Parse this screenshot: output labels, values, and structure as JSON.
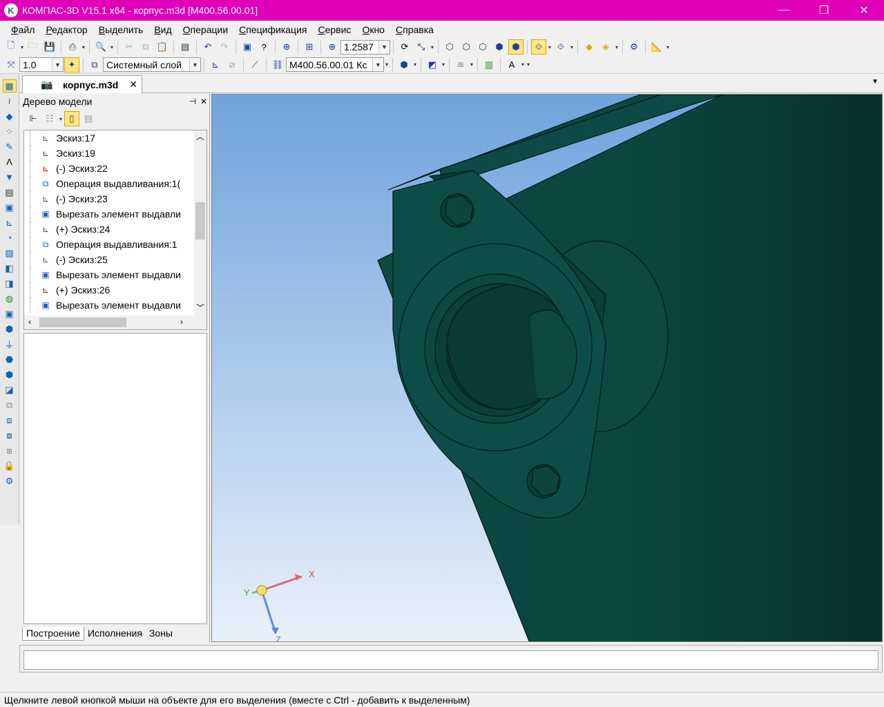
{
  "window": {
    "title": "КОМПАС-3D V15.1 x64 - корпус.m3d [M400.56.00.01]",
    "accent": "#e000b8",
    "minimize": "—",
    "maximize": "❐",
    "close": "✕"
  },
  "menu": [
    "Файл",
    "Редактор",
    "Выделить",
    "Вид",
    "Операции",
    "Спецификация",
    "Сервис",
    "Окно",
    "Справка"
  ],
  "toolbar": {
    "zoom_value": "1.2587",
    "step_value": "1.0",
    "layer_value": "Системный слой",
    "designation_value": "M400.56.00.01 Кс"
  },
  "document_tab": {
    "label": "корпус.m3d",
    "close": "✕"
  },
  "tree_panel": {
    "title": "Дерево модели",
    "pin": "⊣",
    "close": "✕",
    "items": [
      {
        "icon": "sketch-icon",
        "label": "Эскиз:17"
      },
      {
        "icon": "sketch-icon",
        "label": "Эскиз:19"
      },
      {
        "icon": "sketch-error-icon",
        "label": "(-) Эскиз:22"
      },
      {
        "icon": "extrude-icon",
        "label": "Операция выдавливания:1("
      },
      {
        "icon": "sketch-icon",
        "label": "(-) Эскиз:23"
      },
      {
        "icon": "cut-extrude-icon",
        "label": "Вырезать элемент выдавли"
      },
      {
        "icon": "sketch-icon",
        "label": "(+) Эскиз:24"
      },
      {
        "icon": "extrude-icon",
        "label": "Операция выдавливания:1"
      },
      {
        "icon": "sketch-icon",
        "label": "(-) Эскиз:25"
      },
      {
        "icon": "cut-extrude-icon",
        "label": "Вырезать элемент выдавли"
      },
      {
        "icon": "sketch-error-icon",
        "label": "(+) Эскиз:26"
      },
      {
        "icon": "cut-extrude-icon",
        "label": "Вырезать элемент выдавли"
      }
    ],
    "tabs": [
      "Построение",
      "Исполнения",
      "Зоны"
    ],
    "active_tab": "Построение"
  },
  "axes": {
    "x": "X",
    "y": "Y",
    "z": "Z"
  },
  "model_color": "#0e4a45",
  "status_text": "Щелкните левой кнопкой мыши на объекте для его выделения (вместе с Ctrl - добавить к выделенным)"
}
